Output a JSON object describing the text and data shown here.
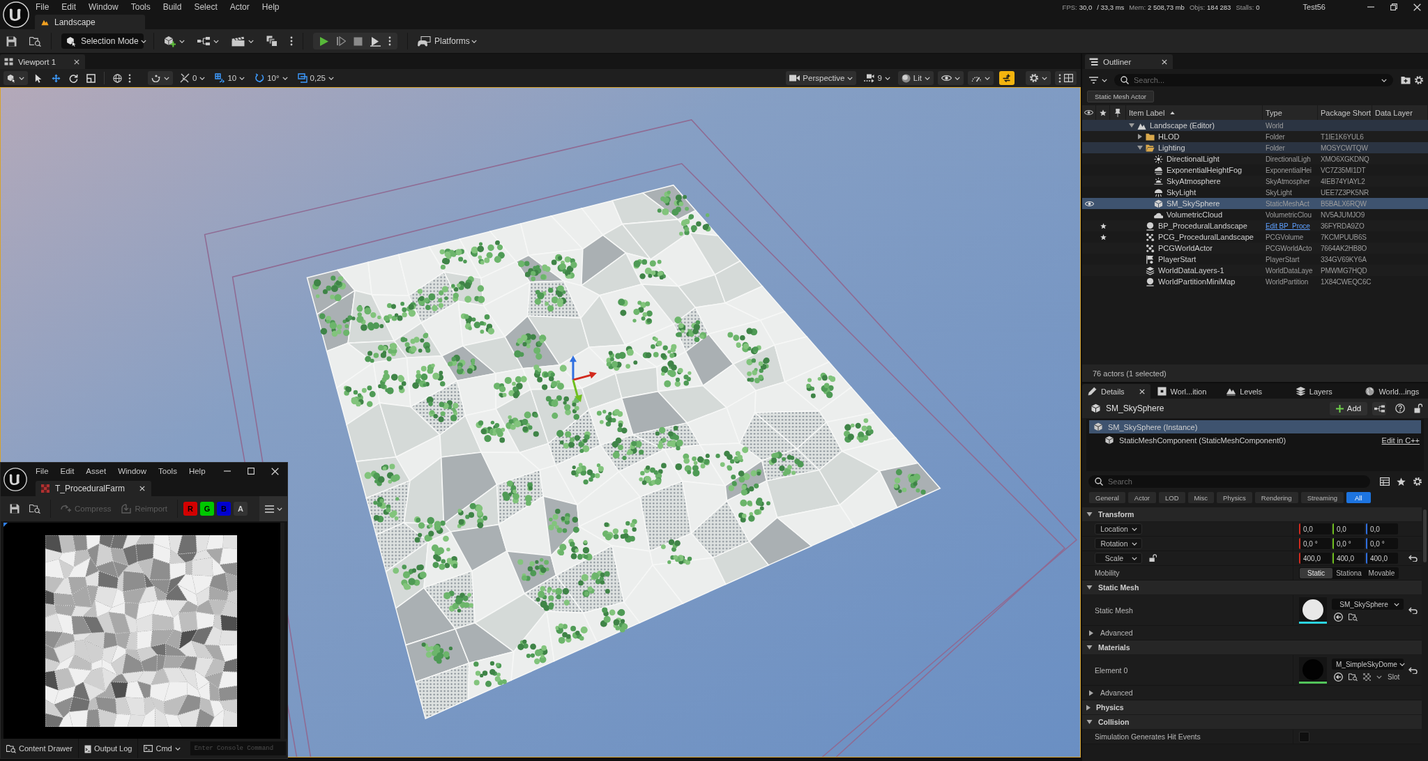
{
  "menu_bar": {
    "items": [
      "File",
      "Edit",
      "Window",
      "Tools",
      "Build",
      "Select",
      "Actor",
      "Help"
    ],
    "level_tab": "Landscape",
    "stats": [
      {
        "label": "FPS:",
        "value": "30,0"
      },
      {
        "value": "/ 33,3 ms"
      },
      {
        "label": "Mem:",
        "value": "2 508,73 mb"
      },
      {
        "label": "Objs:",
        "value": "184 283"
      },
      {
        "label": "Stalls:",
        "value": "0"
      }
    ],
    "project": "Test56"
  },
  "toolbar": {
    "mode": "Selection Mode",
    "platforms": "Platforms"
  },
  "viewport": {
    "tab": "Viewport 1",
    "tools": [
      {
        "kind": "select",
        "selected": false
      },
      {
        "kind": "translate",
        "selected": true
      },
      {
        "kind": "rotate",
        "selected": false
      },
      {
        "kind": "scale",
        "selected": false
      }
    ],
    "snaps": [
      {
        "kind": "surface",
        "value": "0",
        "on": false
      },
      {
        "kind": "grid",
        "value": "10",
        "on": true
      },
      {
        "kind": "rotation",
        "value": "10°",
        "on": true
      },
      {
        "kind": "scale",
        "value": "0,25",
        "on": true
      }
    ],
    "projection": "Perspective",
    "camera_speed": "9",
    "view_mode": "Lit",
    "status_toggle": {
      "on": true
    }
  },
  "outliner": {
    "tab": "Outliner",
    "search": {
      "placeholder": "Search..."
    },
    "filter": "Static Mesh Actor",
    "columns": [
      "Item Label",
      "Type",
      "Package Short",
      "Data Layer"
    ],
    "items": [
      {
        "label": "Landscape (Editor)",
        "kind": "world",
        "type": "World",
        "selected": false,
        "starred": false,
        "expanded": true,
        "children": [
          {
            "label": "HLOD",
            "kind": "folder",
            "type": "Folder",
            "package": "T1IE1K6YUL6",
            "selected": false,
            "starred": false,
            "expanded": false
          },
          {
            "label": "Lighting",
            "kind": "folder",
            "type": "Folder",
            "package": "MOSYCWTQW",
            "selected": false,
            "starred": false,
            "expanded": true,
            "children": [
              {
                "label": "DirectionalLight",
                "kind": "directional_light",
                "type": "DirectionalLigh",
                "package": "XMO6XGKDNQ",
                "selected": false,
                "starred": false
              },
              {
                "label": "ExponentialHeightFog",
                "kind": "fog",
                "type": "ExponentialHei",
                "package": "VC7Z35MI1DT",
                "selected": false,
                "starred": false
              },
              {
                "label": "SkyAtmosphere",
                "kind": "sky_atmosphere",
                "type": "SkyAtmospher",
                "package": "4IEB74YIAYL2",
                "selected": false,
                "starred": false
              },
              {
                "label": "SkyLight",
                "kind": "sky_light",
                "type": "SkyLight",
                "package": "UEE7Z3PK5NR",
                "selected": false,
                "starred": false
              },
              {
                "label": "SM_SkySphere",
                "kind": "static_mesh",
                "type": "StaticMeshAct",
                "package": "B5BALX6RQW",
                "selected": true,
                "starred": false
              },
              {
                "label": "VolumetricCloud",
                "kind": "cloud",
                "type": "VolumetricClou",
                "package": "NV5AJUMJO9",
                "selected": false,
                "starred": false
              }
            ]
          },
          {
            "label": "BP_ProceduralLandscape",
            "kind": "blueprint",
            "type": "Edit BP_Proce",
            "link": true,
            "package": "36FYRDA9ZO",
            "selected": false,
            "starred": true
          },
          {
            "label": "PCG_ProceduralLandscape",
            "kind": "pcg",
            "type": "PCGVolume",
            "package": "7KCMPUUB6S",
            "selected": false,
            "starred": true
          },
          {
            "label": "PCGWorldActor",
            "kind": "pcg",
            "type": "PCGWorldActo",
            "package": "7664AK2HB8O",
            "selected": false,
            "starred": false
          },
          {
            "label": "PlayerStart",
            "kind": "player_start",
            "type": "PlayerStart",
            "package": "334GV69KY6A",
            "selected": false,
            "starred": false
          },
          {
            "label": "WorldDataLayers-1",
            "kind": "data_layers",
            "type": "WorldDataLaye",
            "package": "PMWMG7HQD",
            "selected": false,
            "starred": false
          },
          {
            "label": "WorldPartitionMiniMap",
            "kind": "minimap",
            "type": "WorldPartition",
            "package": "1X84CWEQC6C",
            "selected": false,
            "starred": false
          }
        ]
      }
    ],
    "footer": "76 actors (1 selected)"
  },
  "details": {
    "tabs": [
      {
        "label": "Details",
        "kind": "details",
        "selected": true
      },
      {
        "label": "Worl...ition",
        "kind": "partition",
        "selected": false
      },
      {
        "label": "Levels",
        "kind": "levels",
        "selected": false
      },
      {
        "label": "Layers",
        "kind": "layers",
        "selected": false
      },
      {
        "label": "World...ings",
        "kind": "settings",
        "selected": false
      }
    ],
    "actor": "SM_SkySphere",
    "add": "Add",
    "components": [
      {
        "label": "SM_SkySphere (Instance)",
        "selected": true,
        "children": [
          {
            "label": "StaticMeshComponent (StaticMeshComponent0)",
            "selected": false,
            "link": "Edit in C++"
          }
        ]
      }
    ],
    "search": {
      "placeholder": "Search"
    },
    "filters": [
      {
        "label": "General",
        "selected": false
      },
      {
        "label": "Actor",
        "selected": false
      },
      {
        "label": "LOD",
        "selected": false
      },
      {
        "label": "Misc",
        "selected": false
      },
      {
        "label": "Physics",
        "selected": false
      },
      {
        "label": "Rendering",
        "selected": false
      },
      {
        "label": "Streaming",
        "selected": false
      },
      {
        "label": "All",
        "selected": true
      }
    ],
    "sections": [
      {
        "title": "Transform",
        "expanded": true,
        "rows": [
          {
            "kind": "vector",
            "label": "Location",
            "values": [
              "0,0",
              "0,0",
              "0,0"
            ],
            "reset": false
          },
          {
            "kind": "vector",
            "label": "Rotation",
            "values": [
              "0,0 °",
              "0,0 °",
              "0,0 °"
            ],
            "reset": false
          },
          {
            "kind": "vector",
            "label": "Scale",
            "locked": false,
            "values": [
              "400,0",
              "400,0",
              "400,0"
            ],
            "reset": true
          },
          {
            "kind": "segmented",
            "label": "Mobility",
            "options": [
              {
                "label": "Static",
                "selected": true
              },
              {
                "label": "Stationa",
                "selected": false
              },
              {
                "label": "Movable",
                "selected": false
              }
            ]
          }
        ]
      },
      {
        "title": "Static Mesh",
        "expanded": true,
        "rows": [
          {
            "kind": "mesh_asset",
            "label": "Static Mesh",
            "value": "SM_SkySphere",
            "reset": true
          },
          {
            "kind": "group",
            "label": "Advanced",
            "expanded": false
          }
        ]
      },
      {
        "title": "Materials",
        "expanded": true,
        "rows": [
          {
            "kind": "material_asset",
            "label": "Element 0",
            "value": "M_SimpleSkyDome",
            "slot": "Slot",
            "reset": true
          },
          {
            "kind": "group",
            "label": "Advanced",
            "expanded": false
          }
        ]
      },
      {
        "title": "Physics",
        "expanded": false
      },
      {
        "title": "Collision",
        "expanded": true,
        "rows": [
          {
            "kind": "checkbox",
            "label": "Simulation Generates Hit Events",
            "checked": false
          }
        ]
      }
    ]
  },
  "texture_editor": {
    "menu": [
      "File",
      "Edit",
      "Asset",
      "Window",
      "Tools",
      "Help"
    ],
    "tab": "T_ProceduralFarm",
    "actions": [
      {
        "kind": "compress",
        "label": "Compress",
        "disabled": true
      },
      {
        "kind": "reimport",
        "label": "Reimport",
        "disabled": true
      }
    ],
    "channels": [
      {
        "label": "R",
        "on": true,
        "color": "#d30000"
      },
      {
        "label": "G",
        "on": true,
        "color": "#00c800"
      },
      {
        "label": "B",
        "on": true,
        "color": "#0000d0"
      },
      {
        "label": "A",
        "on": false
      }
    ],
    "status_bar": {
      "content_drawer": "Content Drawer",
      "output_log": "Output Log",
      "cmd": "Cmd",
      "console": {
        "placeholder": "Enter Console Command"
      }
    }
  }
}
